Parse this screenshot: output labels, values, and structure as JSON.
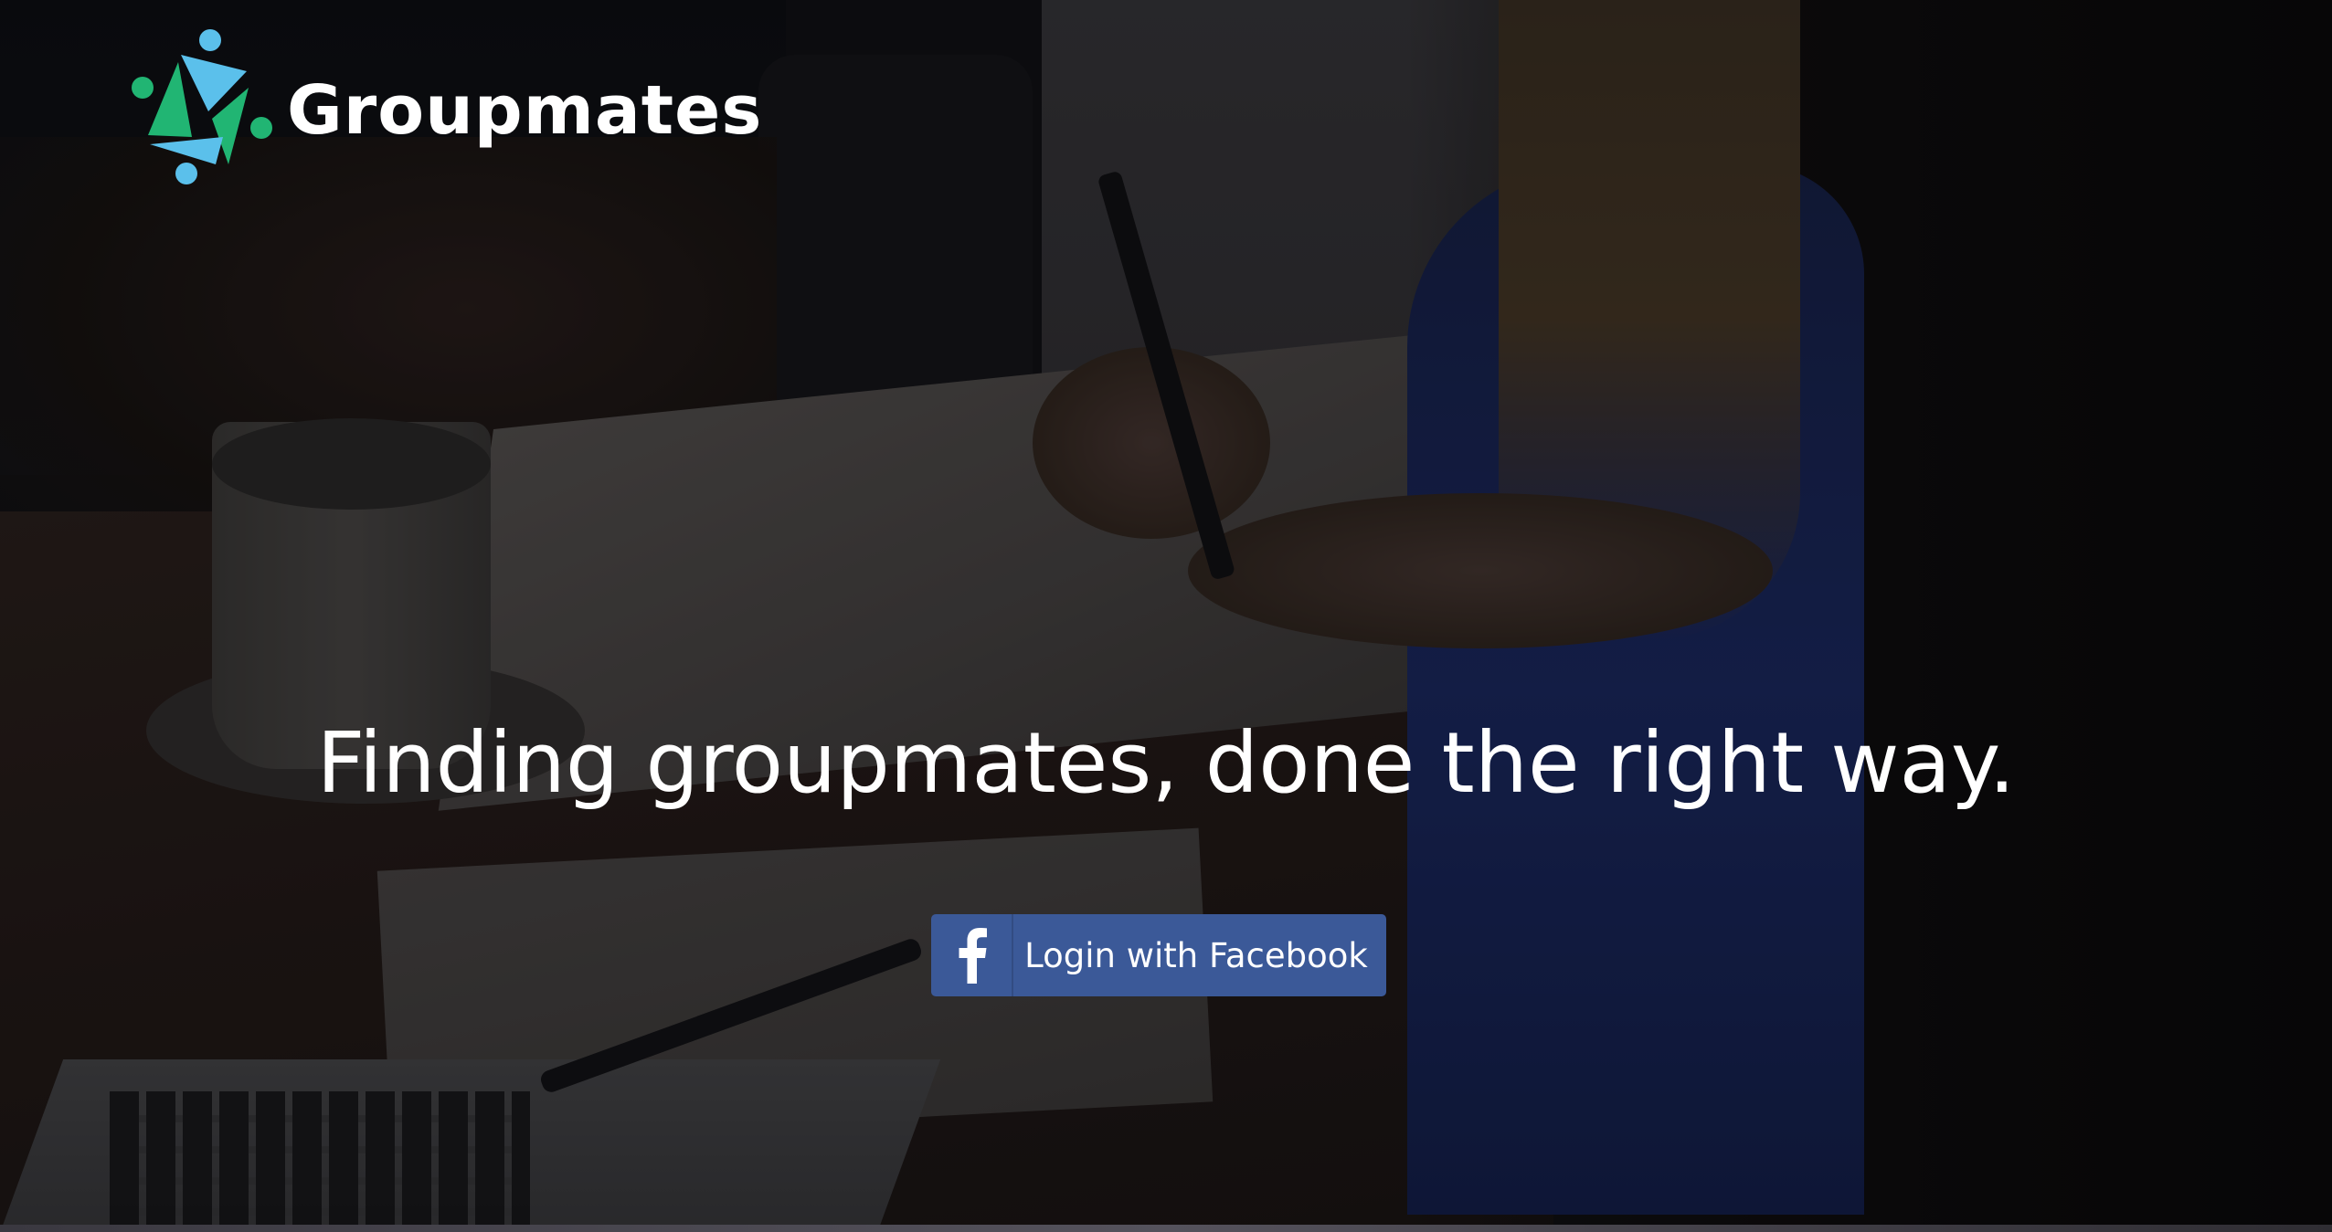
{
  "brand": {
    "name": "Groupmates",
    "logo_icon": "groupmates-logo-icon",
    "colors": {
      "green": "#21b573",
      "blue": "#5bc0eb"
    }
  },
  "hero": {
    "headline": "Finding groupmates, done the right way."
  },
  "login": {
    "facebook_label": "Login with Facebook",
    "facebook_icon": "facebook-icon",
    "facebook_color": "#3b5998"
  }
}
